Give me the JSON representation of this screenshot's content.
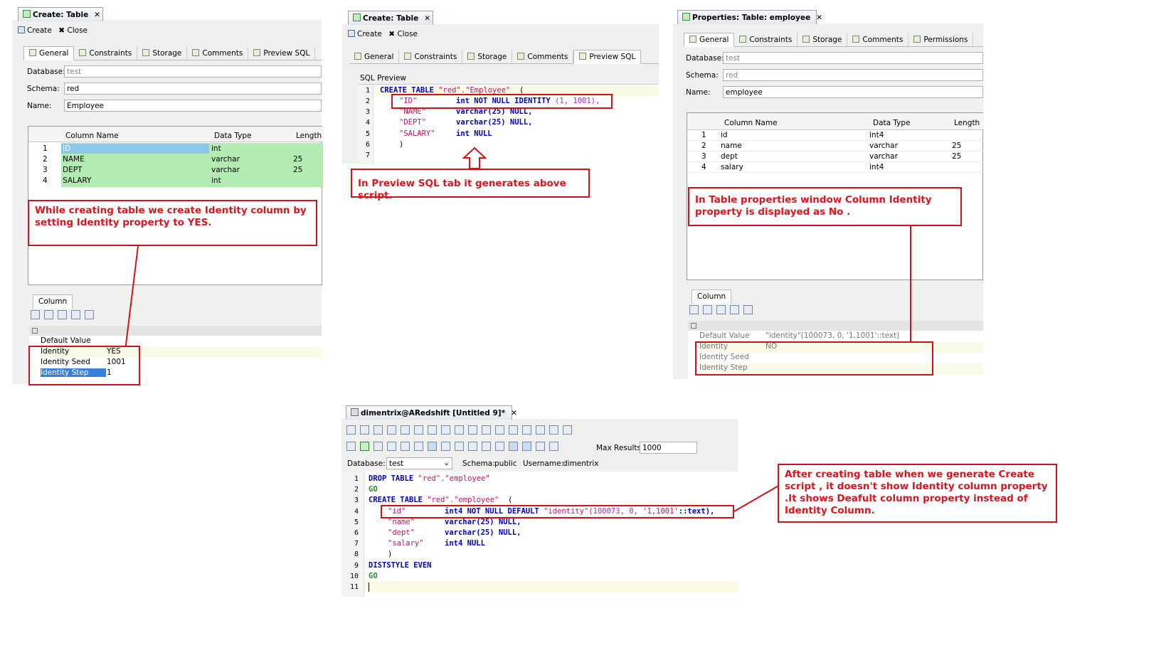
{
  "panel1": {
    "title": "Create: Table",
    "toolbar": {
      "create": "Create",
      "close": "Close"
    },
    "tabs": [
      "General",
      "Constraints",
      "Storage",
      "Comments",
      "Preview SQL"
    ],
    "database_label": "Database:",
    "database_value": "test",
    "schema_label": "Schema:",
    "schema_value": "red",
    "name_label": "Name:",
    "name_value": "Employee",
    "grid_headers": [
      "Column Name",
      "Data Type",
      "Length"
    ],
    "rows": [
      {
        "n": "1",
        "name": "ID",
        "type": "int",
        "len": ""
      },
      {
        "n": "2",
        "name": "NAME",
        "type": "varchar",
        "len": "25"
      },
      {
        "n": "3",
        "name": "DEPT",
        "type": "varchar",
        "len": "25"
      },
      {
        "n": "4",
        "name": "SALARY",
        "type": "int",
        "len": ""
      }
    ],
    "note": "While creating table we create Identity column by setting Identity property to YES.",
    "column_tab": "Column",
    "props": [
      {
        "k": "Default Value",
        "v": ""
      },
      {
        "k": "Identity",
        "v": "YES"
      },
      {
        "k": "Identity Seed",
        "v": "1001"
      },
      {
        "k": "Identity Step",
        "v": "1"
      }
    ]
  },
  "panel2": {
    "title": "Create: Table",
    "toolbar": {
      "create": "Create",
      "close": "Close"
    },
    "tabs": [
      "General",
      "Constraints",
      "Storage",
      "Comments",
      "Preview SQL"
    ],
    "sql_label": "SQL Preview",
    "lines": [
      "1",
      "2",
      "3",
      "4",
      "5",
      "6",
      "7"
    ],
    "code": {
      "l1a": "CREATE TABLE",
      "l1b": "\"red\".\"Employee\"",
      "l1c": "  (",
      "l2a": "\"ID\"",
      "l2b": "int NOT NULL IDENTITY",
      "l2c": "(1, 1001),",
      "l3a": "\"NAME\"",
      "l3b": "varchar(25)",
      "l3c": "NULL,",
      "l4a": "\"DEPT\"",
      "l4b": "varchar(25)",
      "l4c": "NULL,",
      "l5a": "\"SALARY\"",
      "l5b": "int",
      "l5c": "NULL",
      "l6a": ")"
    },
    "note": "In Preview SQL tab it generates above script."
  },
  "panel3": {
    "title": "Properties: Table: employee",
    "tabs": [
      "General",
      "Constraints",
      "Storage",
      "Comments",
      "Permissions"
    ],
    "database_label": "Database:",
    "database_value": "test",
    "schema_label": "Schema:",
    "schema_value": "red",
    "name_label": "Name:",
    "name_value": "employee",
    "grid_headers": [
      "Column Name",
      "Data Type",
      "Length"
    ],
    "rows": [
      {
        "n": "1",
        "name": "id",
        "type": "int4",
        "len": ""
      },
      {
        "n": "2",
        "name": "name",
        "type": "varchar",
        "len": "25"
      },
      {
        "n": "3",
        "name": "dept",
        "type": "varchar",
        "len": "25"
      },
      {
        "n": "4",
        "name": "salary",
        "type": "int4",
        "len": ""
      }
    ],
    "note": "In Table properties window  Column Identity property is displayed as No .",
    "column_tab": "Column",
    "props": [
      {
        "k": "Default Value",
        "v": "\"identity\"(100073, 0, '1,1001'::text)"
      },
      {
        "k": "Identity",
        "v": "NO"
      },
      {
        "k": "Identity Seed",
        "v": ""
      },
      {
        "k": "Identity Step",
        "v": ""
      }
    ]
  },
  "panel4": {
    "title": "dimentrix@ARedshift [Untitled 9]*",
    "max_results_label": "Max Results:",
    "max_results_value": "1000",
    "database_label": "Database:",
    "database_value": "test",
    "schema_label": "Schema:",
    "schema_value": "public",
    "username_label": "Username:",
    "username_value": "dimentrix",
    "lines": [
      "1",
      "2",
      "3",
      "4",
      "5",
      "6",
      "7",
      "8",
      "9",
      "10",
      "11"
    ],
    "code": {
      "l1a": "DROP TABLE",
      "l1b": "\"red\".\"employee\"",
      "l2a": "GO",
      "l3a": "CREATE TABLE",
      "l3b": "\"red\".\"employee\"",
      "l3c": "  (",
      "l4a": "\"id\"",
      "l4b": "int4 NOT NULL DEFAULT",
      "l4c": "\"identity\"(",
      "l4d": "100073, 0,",
      "l4e": "'1,1001'",
      "l4f": "::text),",
      "l5a": "\"name\"",
      "l5b": "varchar(25)",
      "l5c": "NULL,",
      "l6a": "\"dept\"",
      "l6b": "varchar(25)",
      "l6c": "NULL,",
      "l7a": "\"salary\"",
      "l7b": "int4",
      "l7c": "NULL",
      "l8a": ")",
      "l9a": "DISTSTYLE EVEN",
      "l10a": "GO"
    },
    "note": "After creating table when we generate Create script , it doesn't show Identity column property .It shows Deafult column property instead of  Identity Column."
  }
}
